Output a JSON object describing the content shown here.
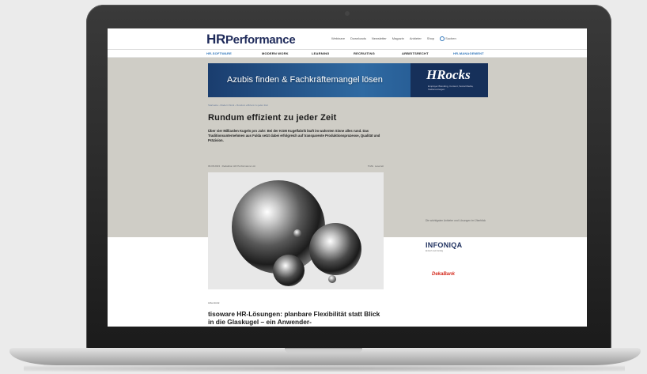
{
  "site": {
    "logo_hr": "HR",
    "logo_rest": "Performance"
  },
  "topnav": [
    "Webinare",
    "Downloads",
    "Newsletter",
    "Magazin",
    "Anbieter",
    "Shop",
    "Suchen"
  ],
  "mainnav": [
    "HR-SOFTWARE",
    "MODERN WORK",
    "LEARNING",
    "RECRUITING",
    "ARBEITSRECHT",
    "HR-MANAGEMENT"
  ],
  "banner": {
    "text": "Azubis finden & Fachkräftemangel lösen",
    "brand": "HRocks",
    "tagline": "Employer Branding, Content, Social Media, Stellenanzeigen"
  },
  "article": {
    "breadcrumb": "Startseite › Modern Work › Rundum effizient zu jeder Zeit",
    "title": "Rundum effizient zu jeder Zeit",
    "lead": "Über vier Milliarden Kugeln pro Jahr: Bei der KGM Kugelfabrik läuft im wahrsten Sinne alles rund. Das Traditionsunternehmen aus Fulda setzt dabei erfolgreich auf transparente Produktionsprozesse, Qualität und Präzision.",
    "date": "09.08.2023 · Redaktion HR Performance Ltd.",
    "readtime": "5 Min. Lesezeit",
    "ad_label": "Advertorial",
    "teaser": "tisoware HR-Lösungen: planbare Flexibilität statt Blick in die Glaskugel – ein Anwender-"
  },
  "sidebar": {
    "heading": "Die wichtigsten Anbieter und Lösungen im Überblick",
    "partners": [
      "INFONIQA",
      "DekaBank"
    ],
    "infoniqa_sub": "Einfach mehr Erfolg"
  },
  "colors": {
    "gray_panel": "#cfcdc6",
    "brand_blue": "#1e2a5a",
    "link_blue": "#2c73b8",
    "deka_red": "#d42b1e"
  }
}
